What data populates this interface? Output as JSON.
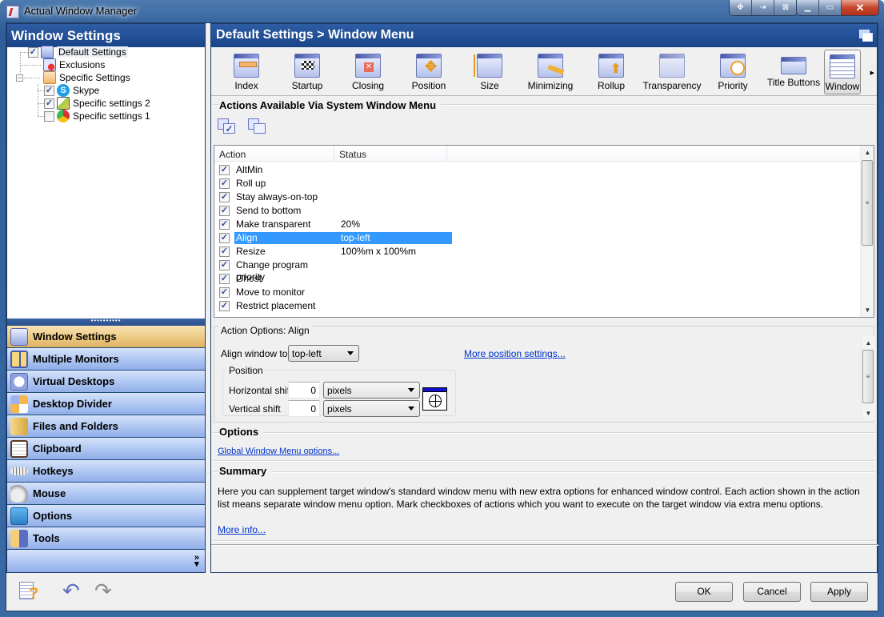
{
  "window": {
    "title": "Actual Window Manager",
    "caption_buttons": [
      "move-icon",
      "pin-icon",
      "minimize-to-tray-icon",
      "minimize-icon",
      "maximize-icon",
      "close-icon"
    ]
  },
  "left": {
    "header": "Window Settings",
    "tree": [
      {
        "label": "Default Settings",
        "checked": true,
        "icon": "default-settings-icon"
      },
      {
        "label": "Exclusions",
        "icon": "exclusions-icon"
      },
      {
        "label": "Specific Settings",
        "expanded": true,
        "icon": "specific-settings-icon"
      },
      {
        "label": "Skype",
        "checked": true,
        "icon": "skype-icon"
      },
      {
        "label": "Specific settings 2",
        "checked": true,
        "icon": "notepad-icon"
      },
      {
        "label": "Specific settings 1",
        "checked": false,
        "icon": "chrome-icon"
      }
    ],
    "nav": [
      {
        "label": "Window Settings",
        "active": true
      },
      {
        "label": "Multiple Monitors"
      },
      {
        "label": "Virtual Desktops"
      },
      {
        "label": "Desktop Divider"
      },
      {
        "label": "Files and Folders"
      },
      {
        "label": "Clipboard"
      },
      {
        "label": "Hotkeys"
      },
      {
        "label": "Mouse"
      },
      {
        "label": "Options"
      },
      {
        "label": "Tools"
      }
    ],
    "nav_more": "»",
    "bottom_icons": [
      "help-icon",
      "undo-icon",
      "redo-icon"
    ]
  },
  "right": {
    "header": "Default Settings > Window Menu",
    "toolbar": [
      "Index",
      "Startup",
      "Closing",
      "Position",
      "Size",
      "Minimizing",
      "Rollup",
      "Transparency",
      "Priority",
      "Title Buttons",
      "Window"
    ],
    "toolbar_selected": "Window",
    "actions_section": "Actions Available Via System Window Menu",
    "list": {
      "columns": [
        "Action",
        "Status"
      ],
      "rows": [
        {
          "action": "AltMin",
          "status": "",
          "checked": true
        },
        {
          "action": "Roll up",
          "status": "",
          "checked": true
        },
        {
          "action": "Stay always-on-top",
          "status": "",
          "checked": true
        },
        {
          "action": "Send to bottom",
          "status": "",
          "checked": true
        },
        {
          "action": "Make transparent",
          "status": "20%",
          "checked": true
        },
        {
          "action": "Align",
          "status": "top-left",
          "checked": true,
          "selected": true
        },
        {
          "action": "Resize",
          "status": "100%m x 100%m",
          "checked": true
        },
        {
          "action": "Change program priority",
          "status": "",
          "checked": true
        },
        {
          "action": "Ghost",
          "status": "",
          "checked": true
        },
        {
          "action": "Move to monitor",
          "status": "",
          "checked": true
        },
        {
          "action": "Restrict placement",
          "status": "",
          "checked": true
        }
      ]
    },
    "action_options": {
      "title": "Action Options: Align",
      "align_label": "Align window to",
      "align_value": "top-left",
      "more_link": "More position settings...",
      "position_group": "Position",
      "h_shift_label": "Horizontal shift",
      "h_shift_value": "0",
      "h_shift_unit": "pixels",
      "v_shift_label": "Vertical shift",
      "v_shift_value": "0",
      "v_shift_unit": "pixels"
    },
    "options_section": "Options",
    "options_link": "Global Window Menu options...",
    "summary_section": "Summary",
    "summary_text": "Here you can supplement target window's standard window menu with new extra options for enhanced window control. Each action shown in the action list means separate window menu option. Mark checkboxes of actions which you want to execute on the target window via extra menu options.",
    "summary_link": "More info..."
  },
  "buttons": {
    "ok": "OK",
    "cancel": "Cancel",
    "apply": "Apply"
  },
  "colors": {
    "header_blue": "#1f4c91",
    "selection": "#3399ff",
    "nav_active": "#eac77e",
    "nav": "#a9c2f0",
    "link": "#0033cc"
  }
}
